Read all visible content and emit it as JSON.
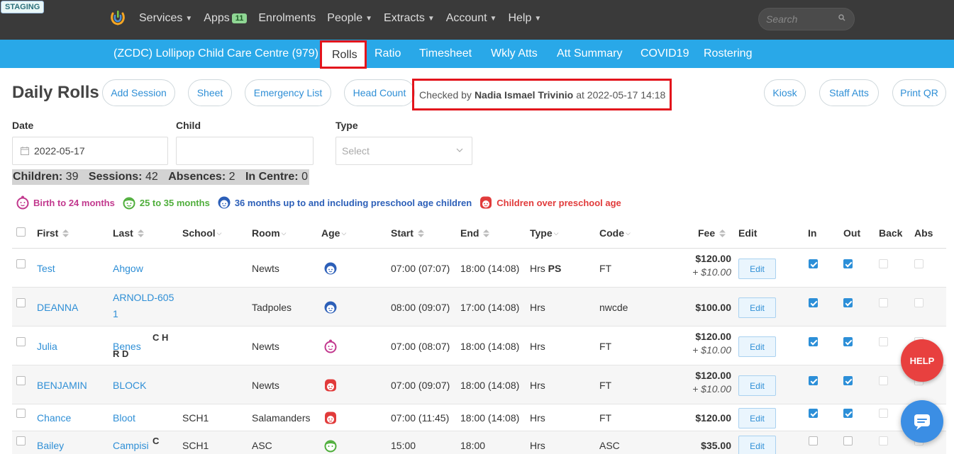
{
  "env_badge": "STAGING",
  "topnav": {
    "items": [
      {
        "label": "Services",
        "caret": true
      },
      {
        "label": "Apps",
        "badge": "11"
      },
      {
        "label": "Enrolments"
      },
      {
        "label": "People",
        "caret": true
      },
      {
        "label": "Extracts",
        "caret": true
      },
      {
        "label": "Account",
        "caret": true
      },
      {
        "label": "Help",
        "caret": true
      }
    ],
    "search_placeholder": "Search"
  },
  "bluebar": {
    "centre": "(ZCDC) Lollipop Child Care Centre (979)",
    "tabs": [
      "Rolls",
      "Ratio",
      "Timesheet",
      "Wkly Atts",
      "Att Summary",
      "COVID19",
      "Rostering"
    ],
    "active_tab": "Rolls"
  },
  "header": {
    "title": "Daily Rolls",
    "buttons": [
      "Add Session",
      "Sheet",
      "Emergency List",
      "Head Count"
    ],
    "checked_prefix": "Checked by",
    "checked_name": "Nadia Ismael Trivinio",
    "checked_suffix": "at 2022-05-17 14:18",
    "right_buttons": [
      "Kiosk",
      "Staff Atts",
      "Print QR"
    ]
  },
  "filters": {
    "date_label": "Date",
    "date_value": "2022-05-17",
    "child_label": "Child",
    "child_value": "",
    "type_label": "Type",
    "type_placeholder": "Select"
  },
  "summary": {
    "children_label": "Children:",
    "children": "39",
    "sessions_label": "Sessions:",
    "sessions": "42",
    "absences_label": "Absences:",
    "absences": "2",
    "incentre_label": "In Centre:",
    "incentre": "0"
  },
  "legend": [
    {
      "label": "Birth to 24 months",
      "color": "#c2398e"
    },
    {
      "label": "25 to 35 months",
      "color": "#4fae3b"
    },
    {
      "label": "36 months up to and including preschool age children",
      "color": "#2c5fb8"
    },
    {
      "label": "Children over preschool age",
      "color": "#e13b3b"
    }
  ],
  "table": {
    "headers": {
      "first": "First",
      "last": "Last",
      "school": "School",
      "room": "Room",
      "age": "Age",
      "start": "Start",
      "end": "End",
      "type": "Type",
      "code": "Code",
      "fee": "Fee",
      "edit": "Edit",
      "in": "In",
      "out": "Out",
      "back": "Back",
      "abs": "Abs"
    },
    "edit_label": "Edit",
    "rows": [
      {
        "first": "Test",
        "last": "Ahgow",
        "last2": "",
        "tag1": "",
        "tag2": "",
        "school": "",
        "room": "Newts",
        "age": "blue",
        "start": "07:00 (07:07)",
        "end": "18:00 (14:08)",
        "type": "Hrs",
        "type_extra": "PS",
        "code": "FT",
        "fee": "$120.00",
        "fee_extra": "+ $10.00",
        "in": true,
        "out": true
      },
      {
        "first": "DEANNA",
        "last": "ARNOLD-605",
        "last2": "1",
        "tag1": "",
        "tag2": "",
        "school": "",
        "room": "Tadpoles",
        "age": "blue",
        "start": "08:00 (09:07)",
        "end": "17:00 (14:08)",
        "type": "Hrs",
        "type_extra": "",
        "code": "nwcde",
        "fee": "$100.00",
        "fee_extra": "",
        "in": true,
        "out": true
      },
      {
        "first": "Julia",
        "last": "Benes",
        "last2": "",
        "tag1": "C H",
        "tag2": "R D",
        "school": "",
        "room": "Newts",
        "age": "pink",
        "start": "07:00 (08:07)",
        "end": "18:00 (14:08)",
        "type": "Hrs",
        "type_extra": "",
        "code": "FT",
        "fee": "$120.00",
        "fee_extra": "+ $10.00",
        "in": true,
        "out": true
      },
      {
        "first": "BENJAMIN",
        "last": "BLOCK",
        "last2": "",
        "tag1": "",
        "tag2": "",
        "school": "",
        "room": "Newts",
        "age": "red",
        "start": "07:00 (09:07)",
        "end": "18:00 (14:08)",
        "type": "Hrs",
        "type_extra": "",
        "code": "FT",
        "fee": "$120.00",
        "fee_extra": "+ $10.00",
        "in": true,
        "out": true
      },
      {
        "first": "Chance",
        "last": "Bloot",
        "last2": "",
        "tag1": "",
        "tag2": "",
        "school": "SCH1",
        "room": "Salamanders",
        "age": "red",
        "start": "07:00 (11:45)",
        "end": "18:00 (14:08)",
        "type": "Hrs",
        "type_extra": "",
        "code": "FT",
        "fee": "$120.00",
        "fee_extra": "",
        "in": true,
        "out": true
      },
      {
        "first": "Bailey",
        "last": "Campisi",
        "last2": "",
        "tag1": "C",
        "tag2": "",
        "school": "SCH1",
        "room": "ASC",
        "age": "green",
        "start": "15:00",
        "end": "18:00",
        "type": "Hrs",
        "type_extra": "",
        "code": "ASC",
        "fee": "$35.00",
        "fee_extra": "",
        "in": false,
        "out": false
      }
    ]
  },
  "floating": {
    "help": "HELP"
  }
}
